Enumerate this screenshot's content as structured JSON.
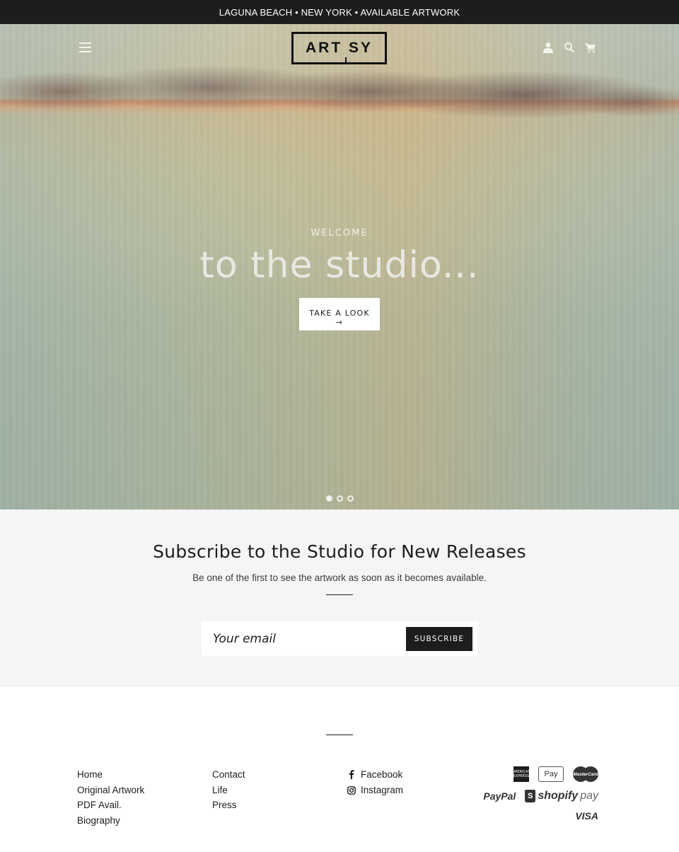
{
  "announcement": {
    "text": "LAGUNA BEACH • NEW YORK • AVAILABLE ARTWORK"
  },
  "header": {
    "logo_text": "ART SY",
    "icons": [
      "menu-icon",
      "account-icon",
      "search-icon",
      "cart-icon"
    ]
  },
  "hero": {
    "eyebrow": "WELCOME",
    "title": "to the studio...",
    "cta_label": "TAKE A LOOK",
    "cta_arrow": "→",
    "slides": {
      "count": 3,
      "active": 1
    }
  },
  "newsletter": {
    "heading": "Subscribe to the Studio for New Releases",
    "subtext": "Be one of the first to see the artwork as soon as it becomes available.",
    "email_placeholder": "Your email",
    "email_value": "",
    "button_label": "SUBSCRIBE"
  },
  "footer": {
    "col1": [
      "Home",
      "Original Artwork",
      "PDF Avail.",
      "Biography"
    ],
    "col2": [
      "Contact",
      "Life",
      "Press"
    ],
    "social": [
      {
        "label": "Facebook",
        "icon": "facebook-icon"
      },
      {
        "label": "Instagram",
        "icon": "instagram-icon"
      }
    ],
    "payments": {
      "amex": "AMERICAN EXPRESS",
      "applepay": " Pay",
      "mastercard": "MasterCard",
      "paypal": "PayPal",
      "shopify_brand": "shopify",
      "shopify_pay": "pay",
      "shopify_bag": "S",
      "visa": "VISA"
    }
  },
  "colors": {
    "dark": "#1c1d1d",
    "newsletter_bg": "#f5f5f5",
    "white": "#ffffff"
  }
}
